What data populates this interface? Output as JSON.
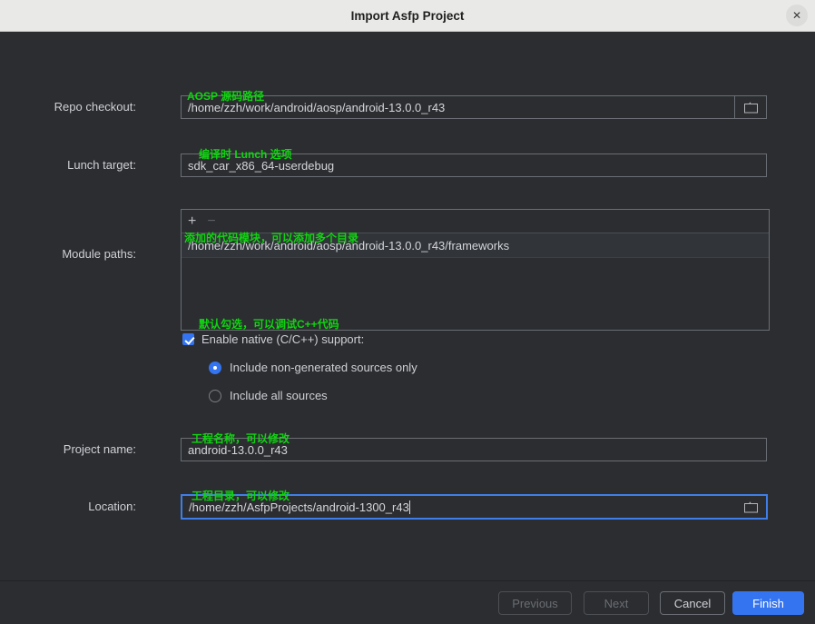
{
  "window": {
    "title": "Import Asfp Project",
    "close_icon": "close-icon"
  },
  "form": {
    "repo_checkout": {
      "label": "Repo checkout:",
      "note": "AOSP 源码路径",
      "value": "/home/zzh/work/android/aosp/android-13.0.0_r43",
      "browse_icon": "folder-icon"
    },
    "lunch_target": {
      "label": "Lunch target:",
      "note": "编译时 Lunch 选项",
      "value": "sdk_car_x86_64-userdebug"
    },
    "module_paths": {
      "label": "Module paths:",
      "note": "添加的代码模块，可以添加多个目录",
      "add_icon": "plus-icon",
      "remove_icon": "minus-icon",
      "items": [
        "/home/zzh/work/android/aosp/android-13.0.0_r43/frameworks"
      ]
    },
    "native_support": {
      "note": "默认勾选，可以调试C++代码",
      "label": "Enable native (C/C++) support:",
      "checked": true,
      "options": [
        {
          "label": "Include non-generated sources only",
          "selected": true
        },
        {
          "label": "Include all sources",
          "selected": false
        }
      ]
    },
    "project_name": {
      "label": "Project name:",
      "note": "工程名称，可以修改",
      "value": "android-13.0.0_r43"
    },
    "location": {
      "label": "Location:",
      "note": "工程目录，可以修改",
      "value": "/home/zzh/AsfpProjects/android-1300_r43",
      "focused": true,
      "browse_icon": "folder-icon"
    }
  },
  "footer": {
    "previous": "Previous",
    "next": "Next",
    "cancel": "Cancel",
    "finish": "Finish"
  },
  "colors": {
    "accent": "#3574f0",
    "note_green": "#11d411",
    "background": "#2b2d30",
    "titlebar": "#e9e9e7"
  }
}
